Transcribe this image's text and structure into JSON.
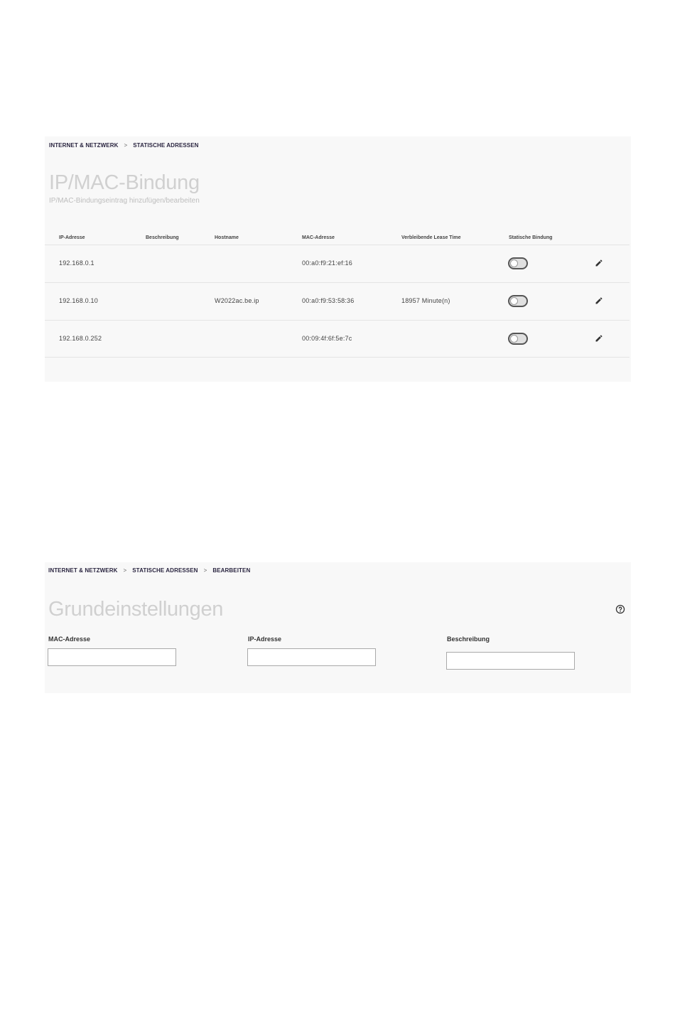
{
  "list_page": {
    "breadcrumb": [
      "INTERNET & NETZWERK",
      "STATISCHE ADRESSEN"
    ],
    "separator": ">",
    "title": "IP/MAC-Bindung",
    "subtitle": "IP/MAC-Bindungseintrag hinzufügen/bearbeiten",
    "columns": {
      "ip": "IP-Adresse",
      "description": "Beschreibung",
      "hostname": "Hostname",
      "mac": "MAC-Adresse",
      "lease": "Verbleibende Lease Time",
      "static": "Statische Bindung"
    },
    "rows": [
      {
        "ip": "192.168.0.1",
        "description": "",
        "hostname": "",
        "mac": "00:a0:f9:21:ef:16",
        "lease": "",
        "static_binding": false
      },
      {
        "ip": "192.168.0.10",
        "description": "",
        "hostname": "W2022ac.be.ip",
        "mac": "00:a0:f9:53:58:36",
        "lease": "18957 Minute(n)",
        "static_binding": false
      },
      {
        "ip": "192.168.0.252",
        "description": "",
        "hostname": "",
        "mac": "00:09:4f:6f:5e:7c",
        "lease": "",
        "static_binding": false
      }
    ]
  },
  "edit_page": {
    "breadcrumb": [
      "INTERNET & NETZWERK",
      "STATISCHE ADRESSEN",
      "BEARBEITEN"
    ],
    "separator": ">",
    "title": "Grundeinstellungen",
    "fields": {
      "mac": {
        "label": "MAC-Adresse",
        "value": ""
      },
      "ip": {
        "label": "IP-Adresse",
        "value": ""
      },
      "description": {
        "label": "Beschreibung",
        "value": ""
      }
    },
    "help_icon": "help-circle-icon"
  },
  "icons": {
    "edit": "pencil-icon",
    "toggle": "toggle-switch"
  },
  "colors": {
    "breadcrumb": "#2a2540",
    "title": "#d0d0d0",
    "panel_bg": "#f8f8f8"
  }
}
